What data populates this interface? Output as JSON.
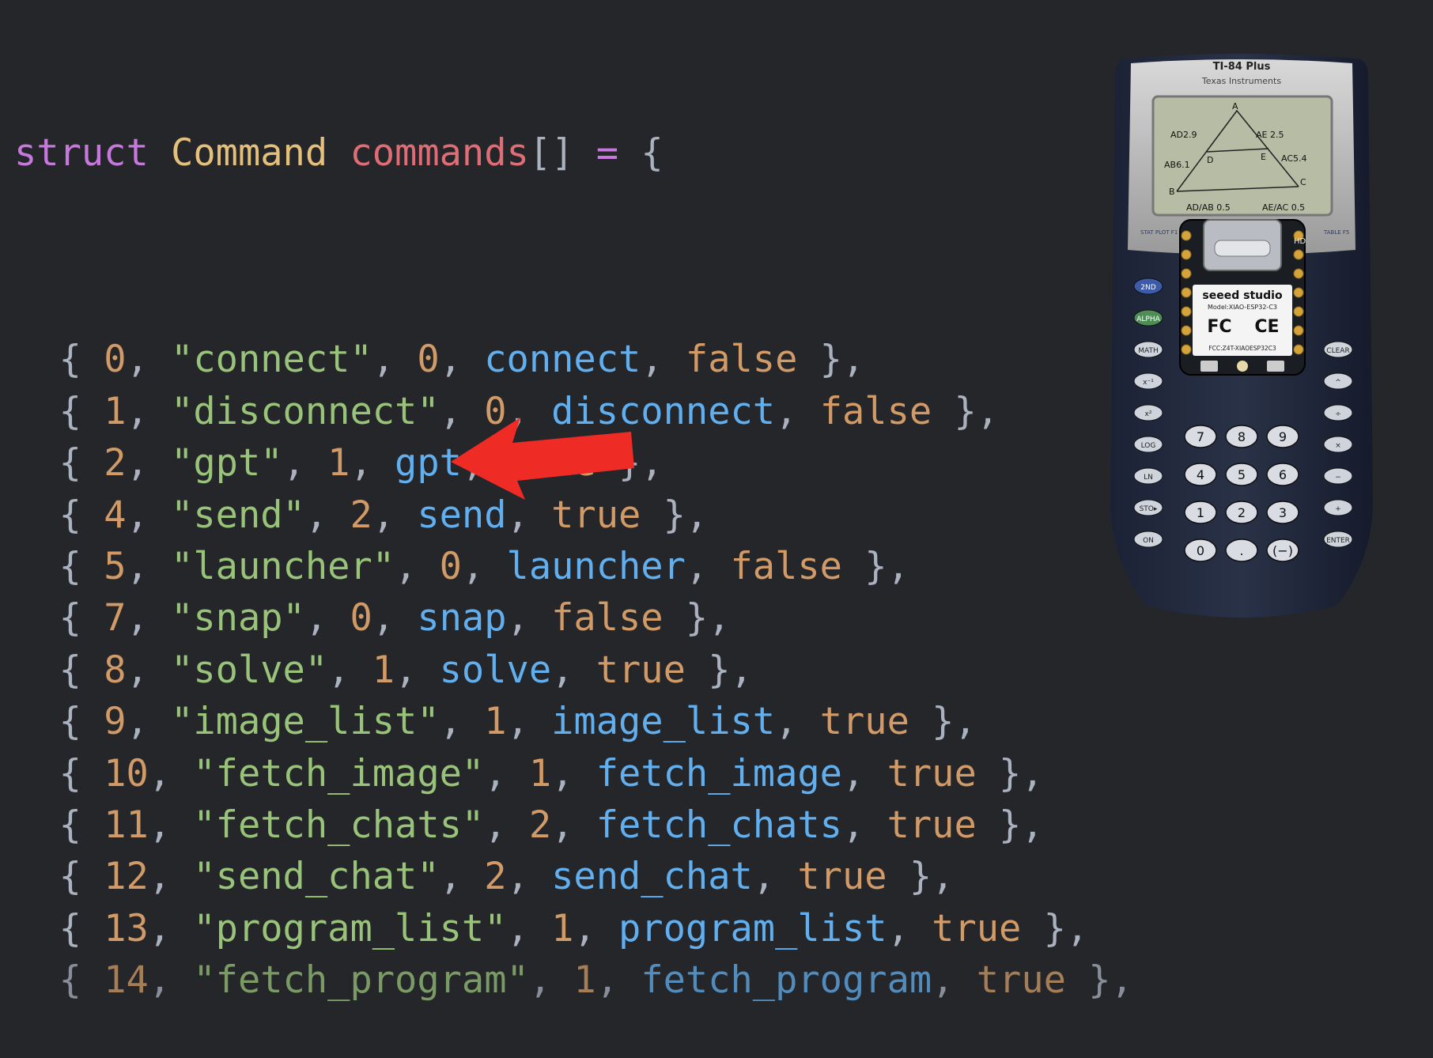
{
  "code": {
    "header": {
      "keyword": "struct",
      "type": "Command",
      "name": "commands",
      "brackets": "[]",
      "eq": "=",
      "brace": "{"
    },
    "rows": [
      {
        "id": "0",
        "name": "\"connect\"",
        "args": "0",
        "fn": "connect",
        "flag": "false"
      },
      {
        "id": "1",
        "name": "\"disconnect\"",
        "args": "0",
        "fn": "disconnect",
        "flag": "false"
      },
      {
        "id": "2",
        "name": "\"gpt\"",
        "args": "1",
        "fn": "gpt",
        "flag": "true"
      },
      {
        "id": "4",
        "name": "\"send\"",
        "args": "2",
        "fn": "send",
        "flag": "true"
      },
      {
        "id": "5",
        "name": "\"launcher\"",
        "args": "0",
        "fn": "launcher",
        "flag": "false"
      },
      {
        "id": "7",
        "name": "\"snap\"",
        "args": "0",
        "fn": "snap",
        "flag": "false"
      },
      {
        "id": "8",
        "name": "\"solve\"",
        "args": "1",
        "fn": "solve",
        "flag": "true"
      },
      {
        "id": "9",
        "name": "\"image_list\"",
        "args": "1",
        "fn": "image_list",
        "flag": "true"
      },
      {
        "id": "10",
        "name": "\"fetch_image\"",
        "args": "1",
        "fn": "fetch_image",
        "flag": "true"
      },
      {
        "id": "11",
        "name": "\"fetch_chats\"",
        "args": "2",
        "fn": "fetch_chats",
        "flag": "true"
      },
      {
        "id": "12",
        "name": "\"send_chat\"",
        "args": "2",
        "fn": "send_chat",
        "flag": "true"
      },
      {
        "id": "13",
        "name": "\"program_list\"",
        "args": "1",
        "fn": "program_list",
        "flag": "true"
      },
      {
        "id": "14",
        "name": "\"fetch_program\"",
        "args": "1",
        "fn": "fetch_program",
        "flag": "true"
      }
    ]
  },
  "arrow": {
    "color": "#ee2b24"
  },
  "calculator": {
    "model": "TI-84 Plus",
    "brand": "Texas Instruments",
    "screen": {
      "labels": [
        "A",
        "AD2.9",
        "AE 2.5",
        "AB6.1",
        "D",
        "E",
        "AC5.4",
        "B",
        "C",
        "AD/AB 0.5",
        "AE/AC 0.5"
      ]
    },
    "top_keys": [
      "STAT PLOT F1",
      "TABLE F5"
    ],
    "side_keys_left": [
      "2ND",
      "ALPHA",
      "MATH",
      "x⁻¹",
      "x²",
      "LOG",
      "LN",
      "STO▸",
      "ON"
    ],
    "side_keys_right": [
      "CLEAR",
      "^",
      "÷",
      "×",
      "−",
      "+",
      "ENTER"
    ],
    "numpad": [
      "7",
      "8",
      "9",
      "4",
      "5",
      "6",
      "1",
      "2",
      "3",
      "0",
      ".",
      "(−)"
    ],
    "chip": {
      "brand": "seeed studio",
      "model": "Model:XIAO-ESP32-C3",
      "fcc_id": "FCC:Z4T-XIAOESP32C3",
      "marks": [
        "FC",
        "CE"
      ],
      "corner": "HD"
    }
  }
}
